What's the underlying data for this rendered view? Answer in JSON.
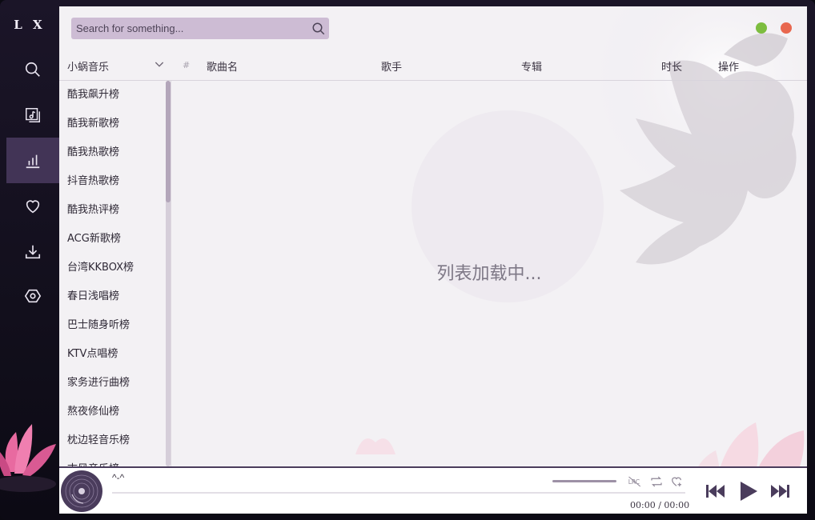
{
  "app": {
    "logo": "L X"
  },
  "nav": [
    {
      "name": "search",
      "icon": "search-icon",
      "active": false
    },
    {
      "name": "songlist",
      "icon": "music-list-icon",
      "active": false
    },
    {
      "name": "leaderboard",
      "icon": "bar-chart-icon",
      "active": true
    },
    {
      "name": "favorites",
      "icon": "heart-icon",
      "active": false
    },
    {
      "name": "download",
      "icon": "download-icon",
      "active": false
    },
    {
      "name": "settings",
      "icon": "settings-icon",
      "active": false
    }
  ],
  "search": {
    "placeholder": "Search for something..."
  },
  "header": {
    "source": "小蜗音乐",
    "index": "#",
    "name": "歌曲名",
    "artist": "歌手",
    "album": "专辑",
    "duration": "时长",
    "action": "操作"
  },
  "boards": [
    "酷我飙升榜",
    "酷我新歌榜",
    "酷我热歌榜",
    "抖音热歌榜",
    "酷我热评榜",
    "ACG新歌榜",
    "台湾KKBOX榜",
    "春日浅唱榜",
    "巴士随身听榜",
    "KTV点唱榜",
    "家务进行曲榜",
    "熬夜修仙榜",
    "枕边轻音乐榜",
    "古风音乐榜"
  ],
  "status": {
    "loading": "列表加载中..."
  },
  "player": {
    "title": "^-^",
    "time_current": "00:00",
    "time_sep": "/",
    "time_total": "00:00",
    "lrc": "LRC"
  },
  "colors": {
    "accent": "#4a3c5c",
    "search_bg": "#cdbcd4",
    "min_button": "#7dbd3f",
    "close_button": "#e8674f"
  }
}
